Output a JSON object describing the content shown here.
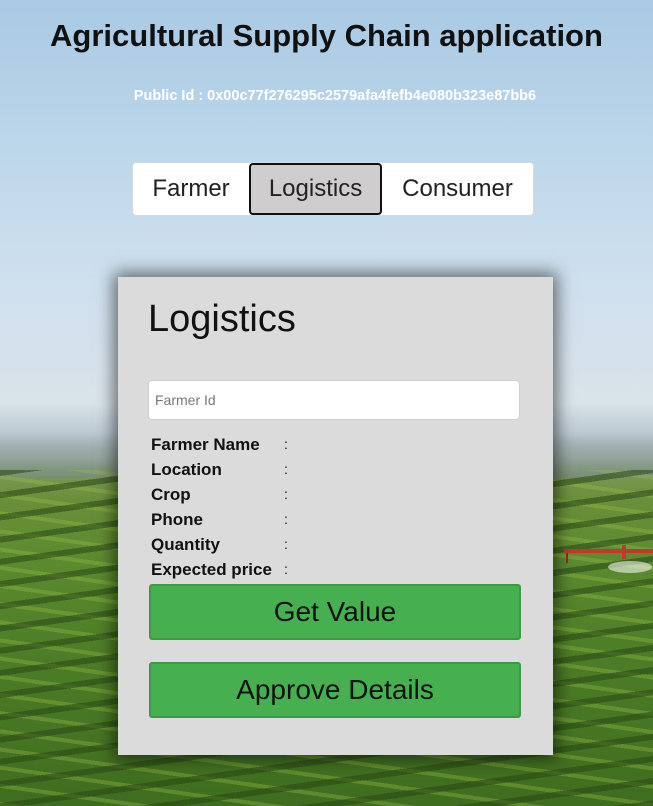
{
  "header": {
    "title": "Agricultural Supply Chain application",
    "public_id": "Public Id : 0x00c77f276295c2579afa4fefb4e080b323e87bb6"
  },
  "tabs": [
    {
      "label": "Farmer",
      "active": false
    },
    {
      "label": "Logistics",
      "active": true
    },
    {
      "label": "Consumer",
      "active": false
    }
  ],
  "card": {
    "title": "Logistics",
    "farmer_id_input": {
      "placeholder": "Farmer Id",
      "value": ""
    },
    "fields": [
      {
        "label": "Farmer Name",
        "separator": ":",
        "value": ""
      },
      {
        "label": "Location",
        "separator": ":",
        "value": ""
      },
      {
        "label": "Crop",
        "separator": ":",
        "value": ""
      },
      {
        "label": "Phone",
        "separator": ":",
        "value": ""
      },
      {
        "label": "Quantity",
        "separator": ":",
        "value": ""
      },
      {
        "label": "Expected price",
        "separator": ":",
        "value": ""
      }
    ],
    "get_value_label": "Get Value",
    "approve_label": "Approve Details"
  },
  "colors": {
    "button_green": "#46af50",
    "active_tab": "#cfcdcd",
    "card_background": "#dcdbdc"
  }
}
